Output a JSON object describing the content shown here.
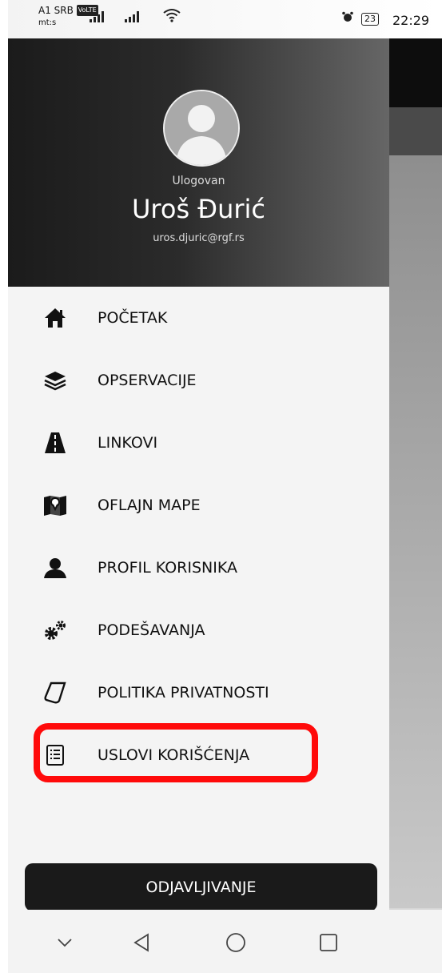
{
  "status_bar": {
    "carrier": "A1 SRB",
    "volte": "VoLTE",
    "carrier_sub": "mt:s",
    "battery": "23",
    "time": "22:29"
  },
  "drawer": {
    "header": {
      "logged_label": "Ulogovan",
      "user_name": "Uroš Đurić",
      "user_email": "uros.djuric@rgf.rs"
    },
    "items": [
      {
        "label": "POČETAK",
        "icon": "home-icon"
      },
      {
        "label": "OPSERVACIJE",
        "icon": "layers-icon"
      },
      {
        "label": "LINKOVI",
        "icon": "road-icon"
      },
      {
        "label": "OFLAJN MAPE",
        "icon": "map-pin-icon"
      },
      {
        "label": "PROFIL KORISNIKA",
        "icon": "user-icon"
      },
      {
        "label": "PODEŠAVANJA",
        "icon": "gears-icon"
      },
      {
        "label": "POLITIKA PRIVATNOSTI",
        "icon": "scroll-icon"
      },
      {
        "label": "USLOVI KORIŠĆENJA",
        "icon": "list-document-icon"
      }
    ],
    "logout_label": "ODJAVLJIVANJE"
  },
  "colors": {
    "highlight": "#ff0a0a",
    "logout_bg": "#1a1a1a"
  }
}
